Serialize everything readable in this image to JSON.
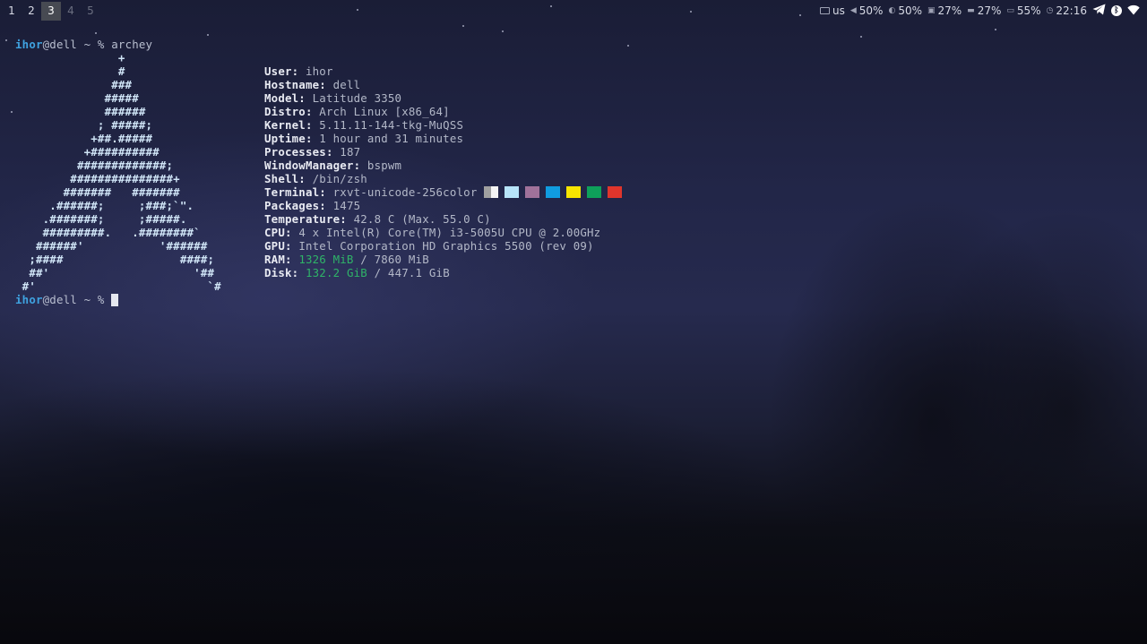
{
  "workspaces": [
    {
      "label": "1",
      "state": "occupied"
    },
    {
      "label": "2",
      "state": "occupied"
    },
    {
      "label": "3",
      "state": "active"
    },
    {
      "label": "4",
      "state": "empty"
    },
    {
      "label": "5",
      "state": "empty"
    }
  ],
  "status": {
    "keyboard_layout": "us",
    "volume": "50%",
    "brightness": "50%",
    "cpu": "27%",
    "memory": "27%",
    "battery": "55%",
    "clock": "22:16",
    "icons": [
      "keyboard-icon",
      "volume-icon",
      "brightness-icon",
      "cpu-icon",
      "memory-icon",
      "battery-icon",
      "clock-icon",
      "telegram-icon",
      "bluetooth-icon",
      "wifi-icon"
    ]
  },
  "terminal": {
    "prompt_user": "ihor",
    "prompt_rest": "@dell ~ % ",
    "command": "archey",
    "logo_lines": [
      "               +",
      "               #",
      "              ###",
      "             #####",
      "             ######",
      "            ; #####;",
      "           +##.#####",
      "          +##########",
      "         #############;",
      "        ###############+",
      "       #######   #######",
      "     .######;     ;###;`\".",
      "    .#######;     ;#####.",
      "    #########.   .########`",
      "   ######'           '######",
      "  ;####                 ####;",
      "  ##'                     '##",
      " #'                         `#"
    ],
    "info": [
      {
        "key": "User:",
        "value": "ihor"
      },
      {
        "key": "Hostname:",
        "value": "dell"
      },
      {
        "key": "Model:",
        "value": "Latitude 3350"
      },
      {
        "key": "Distro:",
        "value": "Arch Linux [x86_64]"
      },
      {
        "key": "Kernel:",
        "value": "5.11.11-144-tkg-MuQSS"
      },
      {
        "key": "Uptime:",
        "value": "1 hour and 31 minutes"
      },
      {
        "key": "Processes:",
        "value": "187"
      },
      {
        "key": "WindowManager:",
        "value": "bspwm"
      },
      {
        "key": "Shell:",
        "value": "/bin/zsh"
      },
      {
        "key": "Terminal:",
        "value": "rxvt-unicode-256color"
      },
      {
        "key": "Packages:",
        "value": "1475"
      },
      {
        "key": "Temperature:",
        "value": "42.8 C (Max. 55.0 C)"
      },
      {
        "key": "CPU:",
        "value": "4 x Intel(R) Core(TM) i3-5005U CPU @ 2.00GHz"
      },
      {
        "key": "GPU:",
        "value": "Intel Corporation HD Graphics 5500 (rev 09)"
      },
      {
        "key": "RAM:",
        "used": "1326 MiB",
        "total": " / 7860 MiB"
      },
      {
        "key": "Disk:",
        "used": "132.2 GiB",
        "total": " / 447.1 GiB"
      }
    ],
    "swatch_colors": [
      "#a0a0a0",
      "#b7e4f9",
      "#a0729a",
      "#109ce0",
      "#f8e500",
      "#0ea05a",
      "#e0352c"
    ]
  }
}
